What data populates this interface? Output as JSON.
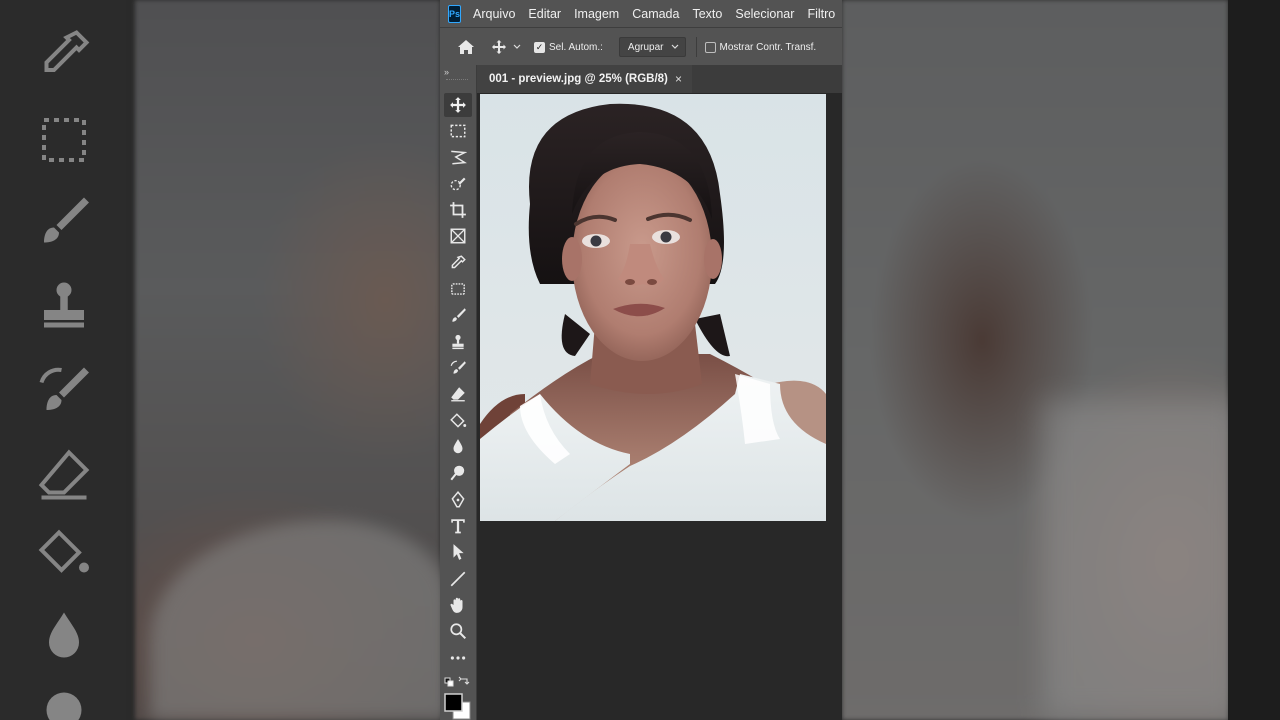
{
  "app": {
    "logo_text": "Ps",
    "menu": [
      "Arquivo",
      "Editar",
      "Imagem",
      "Camada",
      "Texto",
      "Selecionar",
      "Filtro"
    ]
  },
  "options_bar": {
    "auto_select_label": "Sel. Autom.:",
    "auto_select_checked": true,
    "group_value": "Agrupar",
    "transform_controls_label": "Mostrar Contr. Transf.",
    "transform_controls_checked": false
  },
  "document": {
    "tab_title": "001 - preview.jpg @ 25% (RGB/8)",
    "close_glyph": "×"
  },
  "tools": [
    {
      "name": "move-tool",
      "icon": "move-icon",
      "active": true
    },
    {
      "name": "marquee-tool",
      "icon": "marquee-icon"
    },
    {
      "name": "lasso-tool",
      "icon": "lasso-icon"
    },
    {
      "name": "quick-selection-tool",
      "icon": "quick-selection-icon"
    },
    {
      "name": "crop-tool",
      "icon": "crop-icon"
    },
    {
      "name": "frame-tool",
      "icon": "frame-icon"
    },
    {
      "name": "eyedropper-tool",
      "icon": "eyedropper-icon"
    },
    {
      "name": "healing-tool",
      "icon": "healing-icon"
    },
    {
      "name": "brush-tool",
      "icon": "brush-icon"
    },
    {
      "name": "stamp-tool",
      "icon": "stamp-icon"
    },
    {
      "name": "history-brush-tool",
      "icon": "history-brush-icon"
    },
    {
      "name": "eraser-tool",
      "icon": "eraser-icon"
    },
    {
      "name": "paint-bucket-tool",
      "icon": "paint-bucket-icon"
    },
    {
      "name": "blur-tool",
      "icon": "blur-drop-icon"
    },
    {
      "name": "dodge-tool",
      "icon": "dodge-icon"
    },
    {
      "name": "pen-tool",
      "icon": "pen-icon"
    },
    {
      "name": "type-tool",
      "icon": "type-icon"
    },
    {
      "name": "path-selection-tool",
      "icon": "arrow-icon"
    },
    {
      "name": "line-tool",
      "icon": "line-icon"
    },
    {
      "name": "hand-tool",
      "icon": "hand-icon"
    },
    {
      "name": "zoom-tool",
      "icon": "zoom-icon"
    },
    {
      "name": "more-tools",
      "icon": "more-icon"
    }
  ],
  "colors": {
    "foreground": "#000000",
    "background": "#ffffff",
    "ps_accent": "#31a8ff"
  }
}
